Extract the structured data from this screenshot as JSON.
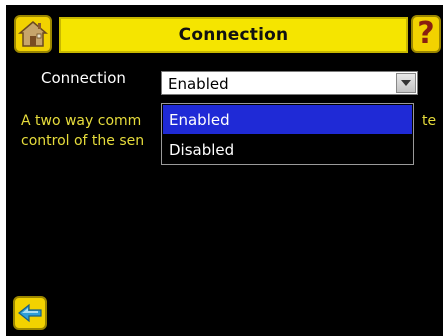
{
  "header": {
    "title": "Connection",
    "home_icon": "home-icon",
    "help_icon": "help-question-icon",
    "help_glyph": "?"
  },
  "field": {
    "label": "Connection",
    "value": "Enabled"
  },
  "description": {
    "line1_visible": "A two way comm",
    "line1_end": "te",
    "line2_visible": "control of the sen"
  },
  "dropdown": {
    "options": [
      "Enabled",
      "Disabled"
    ],
    "selected": "Enabled"
  },
  "footer": {
    "back_icon": "back-arrow-icon"
  },
  "colors": {
    "accent_yellow": "#f5e500",
    "description_text": "#e6dc3c",
    "selection_blue": "#1f2ad6",
    "background": "#000000"
  }
}
